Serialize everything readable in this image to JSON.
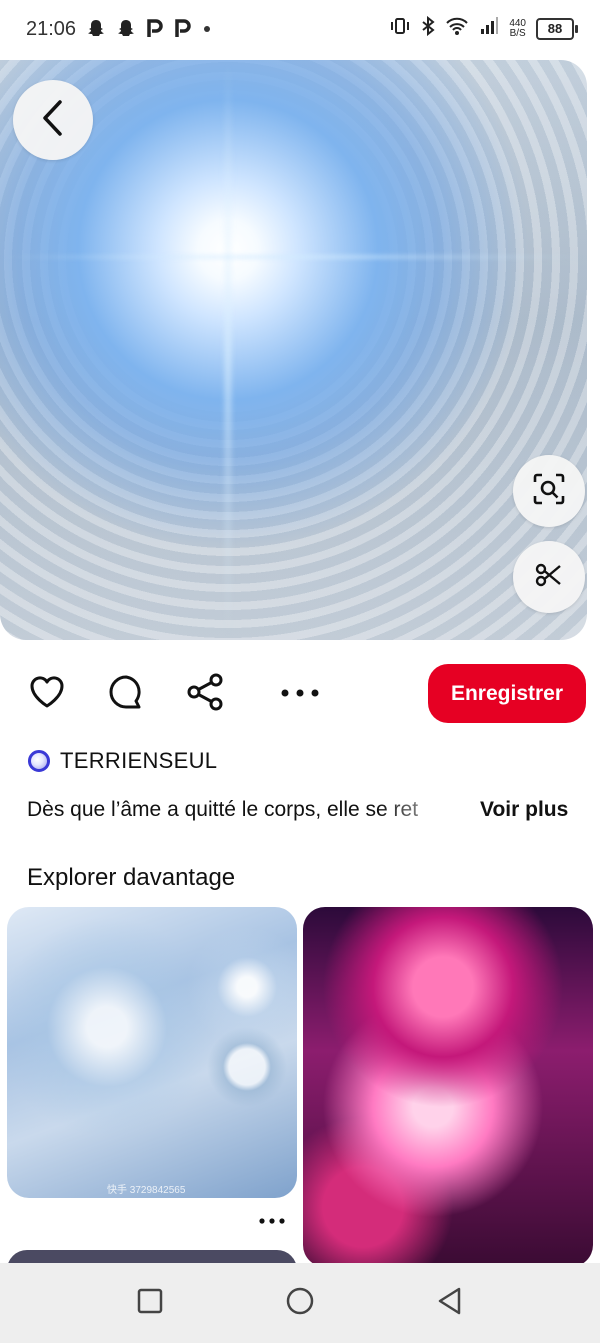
{
  "status_bar": {
    "time": "21:06",
    "left_icons": [
      "snapchat-icon",
      "snapchat-icon",
      "p-icon",
      "p-icon",
      "dot-icon"
    ],
    "net_speed_value": "440",
    "net_speed_unit": "B/S",
    "battery": "88"
  },
  "pin": {
    "actions": {
      "save_label": "Enregistrer"
    },
    "author": "TERRIENSEUL",
    "description": "Dès que l’âme a quitté le corps, elle se ret",
    "more_label": "Voir plus"
  },
  "explore": {
    "title": "Explorer davantage",
    "tile1_watermark": "快手 3729842565"
  },
  "colors": {
    "accent": "#e60023",
    "author_ring": "#3a39d6"
  }
}
